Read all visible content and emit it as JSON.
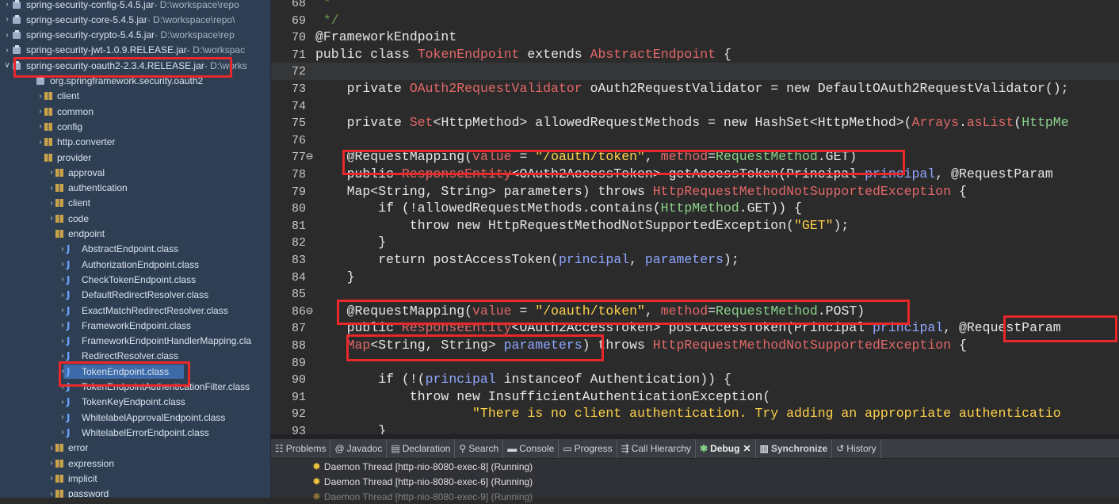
{
  "tree": {
    "items": [
      {
        "label": "spring-security-config-5.4.5.jar",
        "path": " - D:\\workspace\\repo",
        "kind": "jar",
        "indent": 1,
        "chev": "›"
      },
      {
        "label": "spring-security-core-5.4.5.jar",
        "path": " - D:\\workspace\\repo\\",
        "kind": "jar",
        "indent": 1,
        "chev": "›"
      },
      {
        "label": "spring-security-crypto-5.4.5.jar",
        "path": " - D:\\workspace\\rep",
        "kind": "jar",
        "indent": 1,
        "chev": "›"
      },
      {
        "label": "spring-security-jwt-1.0.9.RELEASE.jar",
        "path": " - D:\\workspac",
        "kind": "jar",
        "indent": 1,
        "chev": "›"
      },
      {
        "label": "spring-security-oauth2-2.3.4.RELEASE.jar",
        "path": " - D:\\works",
        "kind": "jar",
        "indent": 1,
        "chev": "∨"
      },
      {
        "label": "org.springframework.security.oauth2",
        "path": "",
        "kind": "pkgroot",
        "indent": 2,
        "chev": ""
      },
      {
        "label": "client",
        "path": "",
        "kind": "pkg",
        "indent": 3,
        "chev": "›"
      },
      {
        "label": "common",
        "path": "",
        "kind": "pkg",
        "indent": 3,
        "chev": "›"
      },
      {
        "label": "config",
        "path": "",
        "kind": "pkg",
        "indent": 3,
        "chev": "›"
      },
      {
        "label": "http.converter",
        "path": "",
        "kind": "pkg",
        "indent": 3,
        "chev": "›"
      },
      {
        "label": "provider",
        "path": "",
        "kind": "pkg",
        "indent": 3,
        "chev": ""
      },
      {
        "label": "approval",
        "path": "",
        "kind": "pkg",
        "indent": 4,
        "chev": "›"
      },
      {
        "label": "authentication",
        "path": "",
        "kind": "pkg",
        "indent": 4,
        "chev": "›"
      },
      {
        "label": "client",
        "path": "",
        "kind": "pkg",
        "indent": 4,
        "chev": "›"
      },
      {
        "label": "code",
        "path": "",
        "kind": "pkg",
        "indent": 4,
        "chev": "›"
      },
      {
        "label": "endpoint",
        "path": "",
        "kind": "pkg",
        "indent": 4,
        "chev": ""
      },
      {
        "label": "AbstractEndpoint.class",
        "path": "",
        "kind": "class",
        "indent": 5,
        "chev": "›"
      },
      {
        "label": "AuthorizationEndpoint.class",
        "path": "",
        "kind": "class",
        "indent": 5,
        "chev": "›"
      },
      {
        "label": "CheckTokenEndpoint.class",
        "path": "",
        "kind": "class",
        "indent": 5,
        "chev": "›"
      },
      {
        "label": "DefaultRedirectResolver.class",
        "path": "",
        "kind": "class",
        "indent": 5,
        "chev": "›"
      },
      {
        "label": "ExactMatchRedirectResolver.class",
        "path": "",
        "kind": "class",
        "indent": 5,
        "chev": "›"
      },
      {
        "label": "FrameworkEndpoint.class",
        "path": "",
        "kind": "annot",
        "indent": 5,
        "chev": "›"
      },
      {
        "label": "FrameworkEndpointHandlerMapping.cla",
        "path": "",
        "kind": "class",
        "indent": 5,
        "chev": "›"
      },
      {
        "label": "RedirectResolver.class",
        "path": "",
        "kind": "iface",
        "indent": 5,
        "chev": "›"
      },
      {
        "label": "TokenEndpoint.class",
        "path": "",
        "kind": "class",
        "indent": 5,
        "chev": "›",
        "selected": true
      },
      {
        "label": "TokenEndpointAuthenticationFilter.class",
        "path": "",
        "kind": "class",
        "indent": 5,
        "chev": "›"
      },
      {
        "label": "TokenKeyEndpoint.class",
        "path": "",
        "kind": "class",
        "indent": 5,
        "chev": "›"
      },
      {
        "label": "WhitelabelApprovalEndpoint.class",
        "path": "",
        "kind": "class",
        "indent": 5,
        "chev": "›"
      },
      {
        "label": "WhitelabelErrorEndpoint.class",
        "path": "",
        "kind": "class",
        "indent": 5,
        "chev": "›"
      },
      {
        "label": "error",
        "path": "",
        "kind": "pkg",
        "indent": 4,
        "chev": "›"
      },
      {
        "label": "expression",
        "path": "",
        "kind": "pkg",
        "indent": 4,
        "chev": "›"
      },
      {
        "label": "implicit",
        "path": "",
        "kind": "pkg",
        "indent": 4,
        "chev": "›"
      },
      {
        "label": "password",
        "path": "",
        "kind": "pkg",
        "indent": 4,
        "chev": "›"
      }
    ]
  },
  "editor": {
    "lines": [
      {
        "n": "68",
        "segs": [
          [
            "cmt",
            " *"
          ]
        ]
      },
      {
        "n": "69",
        "segs": [
          [
            "cmt",
            " */"
          ]
        ]
      },
      {
        "n": "70",
        "segs": [
          [
            "ann",
            "@FrameworkEndpoint"
          ]
        ]
      },
      {
        "n": "71",
        "segs": [
          [
            "kw",
            "public class "
          ],
          [
            "typ",
            "TokenEndpoint"
          ],
          [
            "kw",
            " extends "
          ],
          [
            "typ",
            "AbstractEndpoint"
          ],
          [
            "kw",
            " {"
          ]
        ]
      },
      {
        "n": "72",
        "segs": [],
        "cur": true
      },
      {
        "n": "73",
        "segs": [
          [
            "kw",
            "    private "
          ],
          [
            "typ",
            "OAuth2RequestValidator"
          ],
          [
            "kw",
            " oAuth2RequestValidator = new DefaultOAuth2RequestValidator();"
          ]
        ]
      },
      {
        "n": "74",
        "segs": []
      },
      {
        "n": "75",
        "segs": [
          [
            "kw",
            "    private "
          ],
          [
            "typ",
            "Set"
          ],
          [
            "kw",
            "<HttpMethod> allowedRequestMethods = new HashSet<HttpMethod>("
          ],
          [
            "typ",
            "Arrays"
          ],
          [
            "kw",
            "."
          ],
          [
            "typ",
            "asList"
          ],
          [
            "kw",
            "("
          ],
          [
            "fld",
            "HttpMe"
          ]
        ]
      },
      {
        "n": "76",
        "segs": []
      },
      {
        "n": "77",
        "segs": [
          [
            "ann",
            "    @RequestMapping("
          ],
          [
            "typ",
            "value"
          ],
          [
            "kw",
            " = "
          ],
          [
            "str",
            "\"/oauth/token\""
          ],
          [
            "kw",
            ", "
          ],
          [
            "typ",
            "method"
          ],
          [
            "kw",
            "="
          ],
          [
            "fld",
            "RequestMethod"
          ],
          [
            "kw",
            ".GET)"
          ]
        ],
        "mark": true
      },
      {
        "n": "78",
        "segs": [
          [
            "kw",
            "    public "
          ],
          [
            "typ",
            "ResponseEntity"
          ],
          [
            "kw",
            "<OAuth2AccessToken> getAccessToken(Principal "
          ],
          [
            "prm",
            "principal"
          ],
          [
            "kw",
            ", @RequestParam"
          ]
        ]
      },
      {
        "n": "79",
        "segs": [
          [
            "kw",
            "    Map<String, String> parameters) throws "
          ],
          [
            "typ",
            "HttpRequestMethodNotSupportedException"
          ],
          [
            "kw",
            " {"
          ]
        ]
      },
      {
        "n": "80",
        "segs": [
          [
            "kw",
            "        if (!allowedRequestMethods.contains("
          ],
          [
            "fld",
            "HttpMethod"
          ],
          [
            "kw",
            ".GET)) {"
          ]
        ]
      },
      {
        "n": "81",
        "segs": [
          [
            "kw",
            "            throw new HttpRequestMethodNotSupportedException("
          ],
          [
            "str",
            "\"GET\""
          ],
          [
            "kw",
            ");"
          ]
        ]
      },
      {
        "n": "82",
        "segs": [
          [
            "kw",
            "        }"
          ]
        ]
      },
      {
        "n": "83",
        "segs": [
          [
            "kw",
            "        return postAccessToken("
          ],
          [
            "prm",
            "principal"
          ],
          [
            "kw",
            ", "
          ],
          [
            "prm",
            "parameters"
          ],
          [
            "kw",
            ");"
          ]
        ]
      },
      {
        "n": "84",
        "segs": [
          [
            "kw",
            "    }"
          ]
        ]
      },
      {
        "n": "85",
        "segs": []
      },
      {
        "n": "86",
        "segs": [
          [
            "ann",
            "    @RequestMapping("
          ],
          [
            "typ",
            "value"
          ],
          [
            "kw",
            " = "
          ],
          [
            "str",
            "\"/oauth/token\""
          ],
          [
            "kw",
            ", "
          ],
          [
            "typ",
            "method"
          ],
          [
            "kw",
            "="
          ],
          [
            "fld",
            "RequestMethod"
          ],
          [
            "kw",
            ".POST)"
          ]
        ],
        "mark": true
      },
      {
        "n": "87",
        "segs": [
          [
            "kw",
            "    public "
          ],
          [
            "typ",
            "ResponseEntity"
          ],
          [
            "kw",
            "<OAuth2AccessToken> postAccessToken(Principal "
          ],
          [
            "prm",
            "principal"
          ],
          [
            "kw",
            ", @RequestParam"
          ]
        ]
      },
      {
        "n": "88",
        "segs": [
          [
            "typ",
            "    Map"
          ],
          [
            "kw",
            "<String, String> "
          ],
          [
            "prm",
            "parameters"
          ],
          [
            "kw",
            ") throws "
          ],
          [
            "typ",
            "HttpRequestMethodNotSupportedException"
          ],
          [
            "kw",
            " {"
          ]
        ]
      },
      {
        "n": "89",
        "segs": []
      },
      {
        "n": "90",
        "segs": [
          [
            "kw",
            "        if (!("
          ],
          [
            "prm",
            "principal"
          ],
          [
            "kw",
            " instanceof Authentication)) {"
          ]
        ]
      },
      {
        "n": "91",
        "segs": [
          [
            "kw",
            "            throw new InsufficientAuthenticationException("
          ]
        ]
      },
      {
        "n": "92",
        "segs": [
          [
            "str",
            "                    \"There is no client authentication. Try adding an appropriate authenticatio"
          ]
        ]
      },
      {
        "n": "93",
        "segs": [
          [
            "kw",
            "        }"
          ]
        ]
      }
    ]
  },
  "bottom": {
    "tabs": [
      {
        "icon": "☷",
        "label": "Problems",
        "name": "problems"
      },
      {
        "icon": "@",
        "label": "Javadoc",
        "name": "javadoc"
      },
      {
        "icon": "▤",
        "label": "Declaration",
        "name": "declaration"
      },
      {
        "icon": "⚲",
        "label": "Search",
        "name": "search"
      },
      {
        "icon": "▬",
        "label": "Console",
        "name": "console"
      },
      {
        "icon": "▭",
        "label": "Progress",
        "name": "progress"
      },
      {
        "icon": "⇶",
        "label": "Call Hierarchy",
        "name": "call-hierarchy"
      },
      {
        "icon": "✱",
        "label": "Debug",
        "name": "debug",
        "active": true,
        "close": "✕"
      },
      {
        "icon": "▥",
        "label": "Synchronize",
        "name": "synchronize",
        "bold": true
      },
      {
        "icon": "↺",
        "label": "History",
        "name": "history"
      }
    ],
    "threads": [
      "Daemon Thread [http-nio-8080-exec-8] (Running)",
      "Daemon Thread [http-nio-8080-exec-6] (Running)",
      "Daemon Thread [http-nio-8080-exec-9] (Running)"
    ]
  },
  "colors": {
    "highlight": "#e8282a",
    "selection": "#3d6aa8"
  }
}
